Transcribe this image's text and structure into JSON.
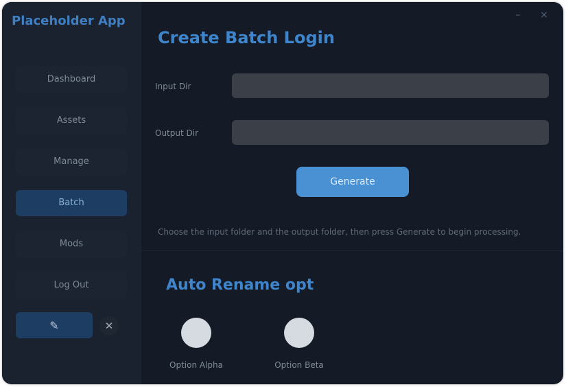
{
  "app": {
    "title": "Placeholder App"
  },
  "sidebar": {
    "items": [
      {
        "label": "Dashboard",
        "active": false
      },
      {
        "label": "Assets",
        "active": false
      },
      {
        "label": "Manage",
        "active": false
      },
      {
        "label": "Batch",
        "active": true
      },
      {
        "label": "Mods",
        "active": false
      },
      {
        "label": "Log Out",
        "active": false
      }
    ],
    "tool_icon": "wand-icon",
    "close_icon": "x-icon"
  },
  "window": {
    "minimize": "–",
    "close": "×"
  },
  "batch": {
    "heading": "Create Batch Login",
    "field1_label": "Input Dir",
    "field1_value": "",
    "field2_label": "Output Dir",
    "field2_value": "",
    "button_label": "Generate",
    "hint": "Choose the input folder and the output folder, then press Generate to begin processing."
  },
  "mode": {
    "heading": "Auto Rename opt",
    "options": [
      {
        "label": "Option Alpha"
      },
      {
        "label": "Option Beta"
      }
    ]
  },
  "colors": {
    "accent": "#3f85cc",
    "button": "#4a91d4",
    "active_item": "#1d3e62",
    "background": "#141b26"
  }
}
